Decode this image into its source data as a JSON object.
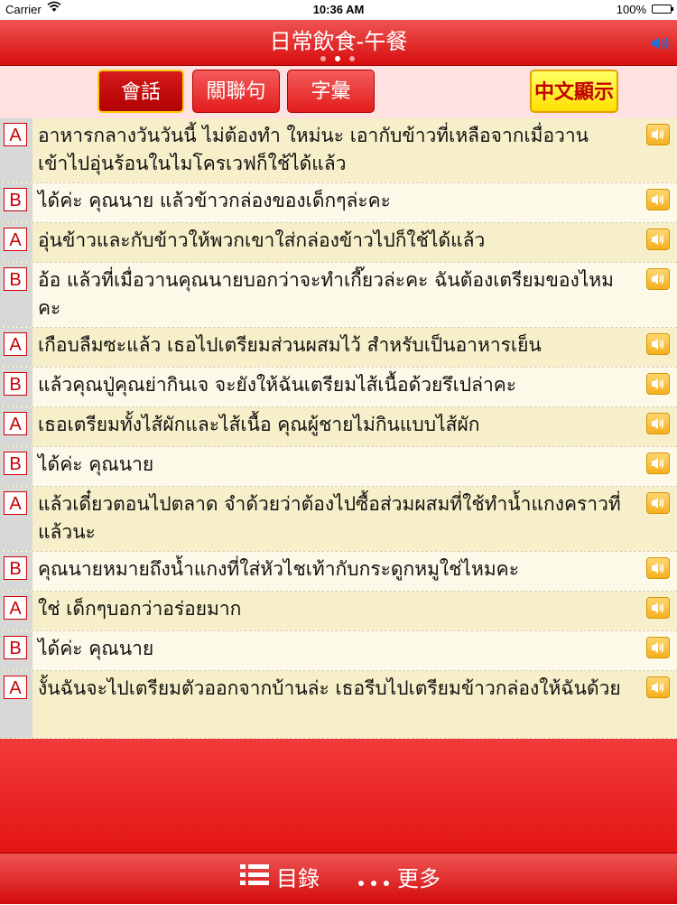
{
  "status_bar": {
    "carrier": "Carrier",
    "time": "10:36 AM",
    "battery": "100%"
  },
  "header": {
    "title": "日常飲食-午餐"
  },
  "tabs": {
    "conversation": "會話",
    "related": "關聯句",
    "vocab": "字彙",
    "show_chinese": "中文顯示"
  },
  "dialog": [
    {
      "speaker": "A",
      "text": "อาหารกลางวันวันนี้ ไม่ต้องทำ ใหม่นะ เอากับข้าวที่เหลือจากเมื่อวาน เข้าไปอุ่นร้อนในไมโครเวฟก็ใช้ได้แล้ว"
    },
    {
      "speaker": "B",
      "text": "ได้ค่ะ คุณนาย แล้วข้าวกล่องของเด็กๆล่ะคะ"
    },
    {
      "speaker": "A",
      "text": "อุ่นข้าวและกับข้าวให้พวกเขาใส่กล่องข้าวไปก็ใช้ได้แล้ว"
    },
    {
      "speaker": "B",
      "text": "อ้อ แล้วที่เมื่อวานคุณนายบอกว่าจะทำเกี๊ยวล่ะคะ ฉันต้องเตรียมของไหมคะ"
    },
    {
      "speaker": "A",
      "text": "เกือบลืมซะแล้ว เธอไปเตรียมส่วนผสมไว้ สำหรับเป็นอาหารเย็น"
    },
    {
      "speaker": "B",
      "text": "แล้วคุณปู่คุณย่ากินเจ จะยังให้ฉันเตรียมไส้เนื้อด้วยรึเปล่าคะ"
    },
    {
      "speaker": "A",
      "text": "เธอเตรียมทั้งไส้ผักและไส้เนื้อ คุณผู้ชายไม่กินแบบไส้ผัก"
    },
    {
      "speaker": "B",
      "text": "ได้ค่ะ คุณนาย"
    },
    {
      "speaker": "A",
      "text": "แล้วเดี๋ยวตอนไปตลาด จำด้วยว่าต้องไปซื้อส่วมผสมที่ใช้ทำน้ำแกงคราวที่แล้วนะ"
    },
    {
      "speaker": "B",
      "text": "คุณนายหมายถึงน้ำแกงที่ใส่หัวไชเท้ากับกระดูกหมูใช่ไหมคะ"
    },
    {
      "speaker": "A",
      "text": "ใช่ เด็กๆบอกว่าอร่อยมาก"
    },
    {
      "speaker": "B",
      "text": "ได้ค่ะ คุณนาย"
    },
    {
      "speaker": "A",
      "text": "งั้นฉันจะไปเตรียมตัวออกจากบ้านล่ะ เธอรีบไปเตรียมข้าวกล่องให้ฉันด้วย"
    }
  ],
  "bottom_bar": {
    "contents": "目錄",
    "more": "更多"
  }
}
